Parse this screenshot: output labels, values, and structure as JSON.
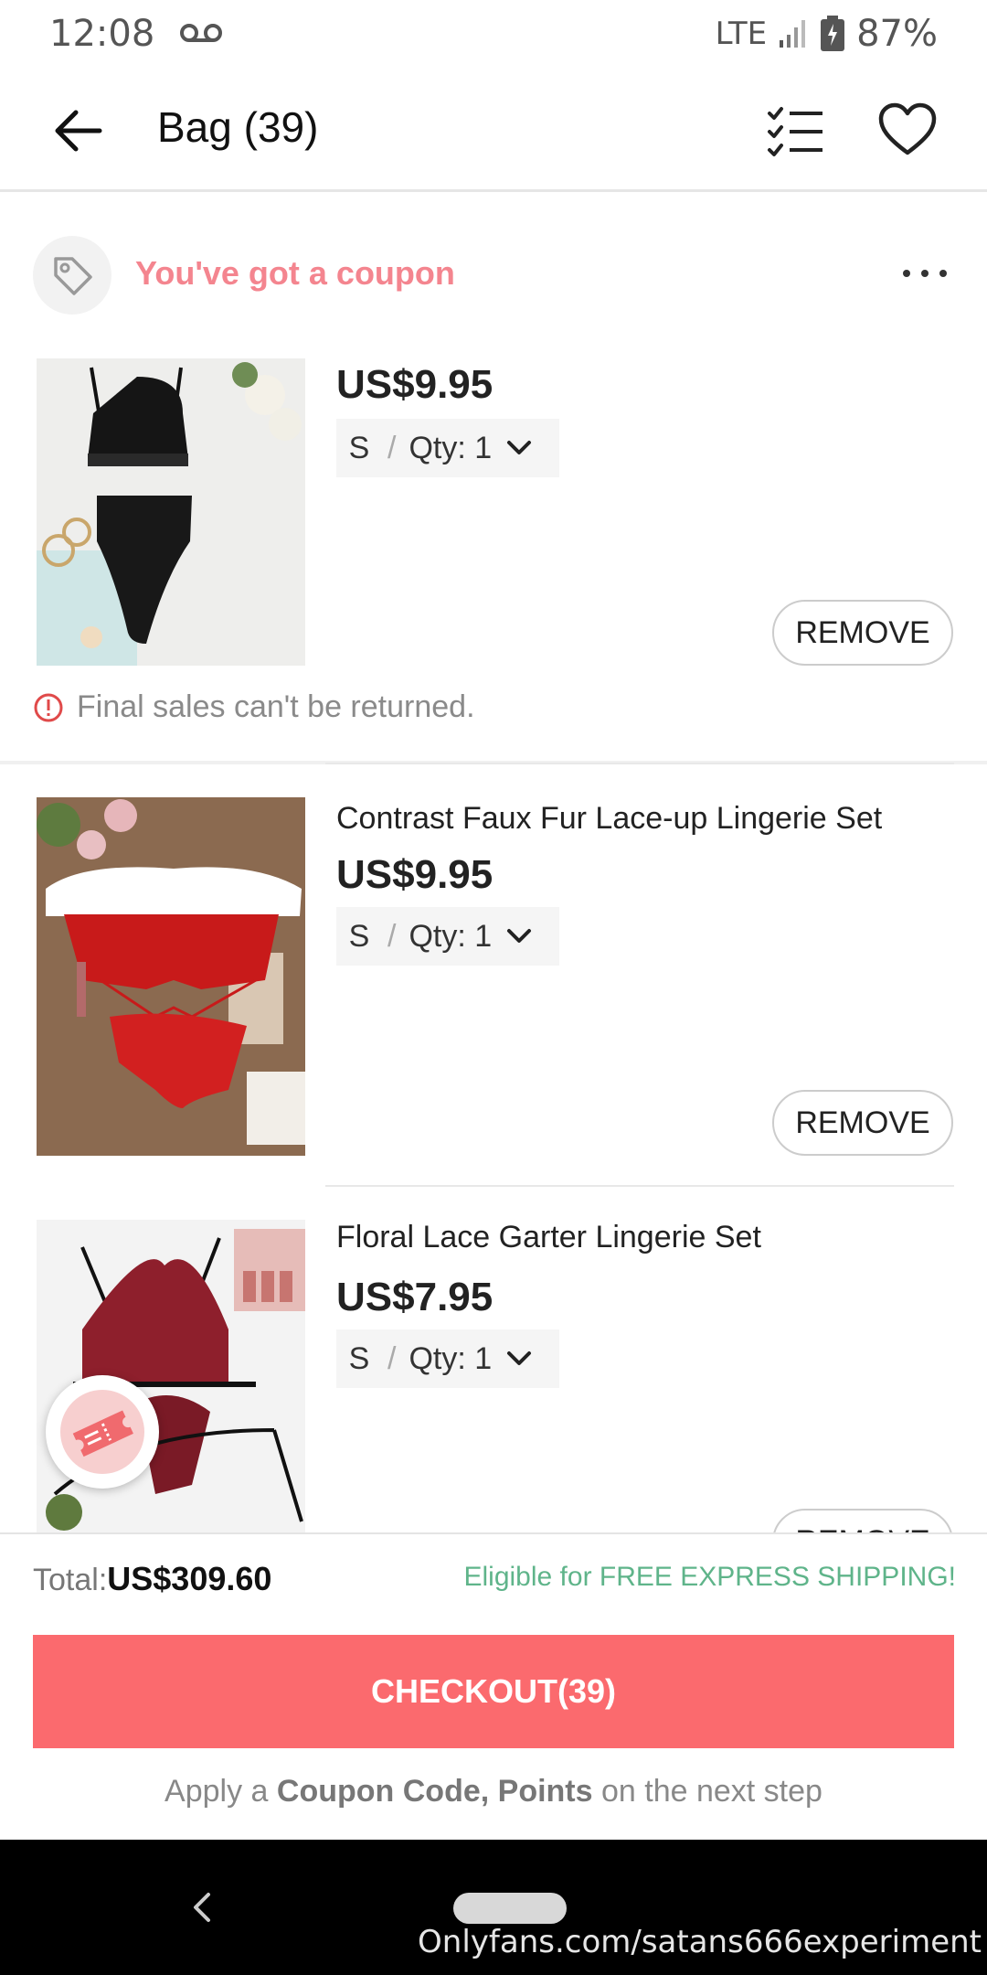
{
  "status_bar": {
    "time": "12:08",
    "network": "LTE",
    "battery": "87%"
  },
  "header": {
    "title": "Bag (39)"
  },
  "coupon": {
    "text": "You've got a coupon"
  },
  "items": [
    {
      "name": "",
      "price": "US$9.95",
      "size": "S",
      "qty": "Qty: 1",
      "remove": "REMOVE"
    },
    {
      "name": "Contrast Faux Fur Lace-up Lingerie Set",
      "price": "US$9.95",
      "size": "S",
      "qty": "Qty: 1",
      "remove": "REMOVE"
    },
    {
      "name": "Floral Lace Garter Lingerie Set",
      "price": "US$7.95",
      "size": "S",
      "qty": "Qty: 1",
      "remove": "REMOVE"
    }
  ],
  "notice": {
    "final_sale": "Final sales can't be returned."
  },
  "summary": {
    "total_label": "Total:",
    "total_value": "US$309.60",
    "shipping": "Eligible for FREE EXPRESS SHIPPING!",
    "checkout": "CHECKOUT(39)",
    "apply_prefix": "Apply a",
    "apply_bold": "Coupon Code, Points",
    "apply_suffix": "on the next step"
  },
  "watermark": "Onlyfans.com/satans666experiment",
  "colors": {
    "accent": "#fb6a6e",
    "coupon_text": "#f4858f",
    "shipping_text": "#5fb48a"
  }
}
